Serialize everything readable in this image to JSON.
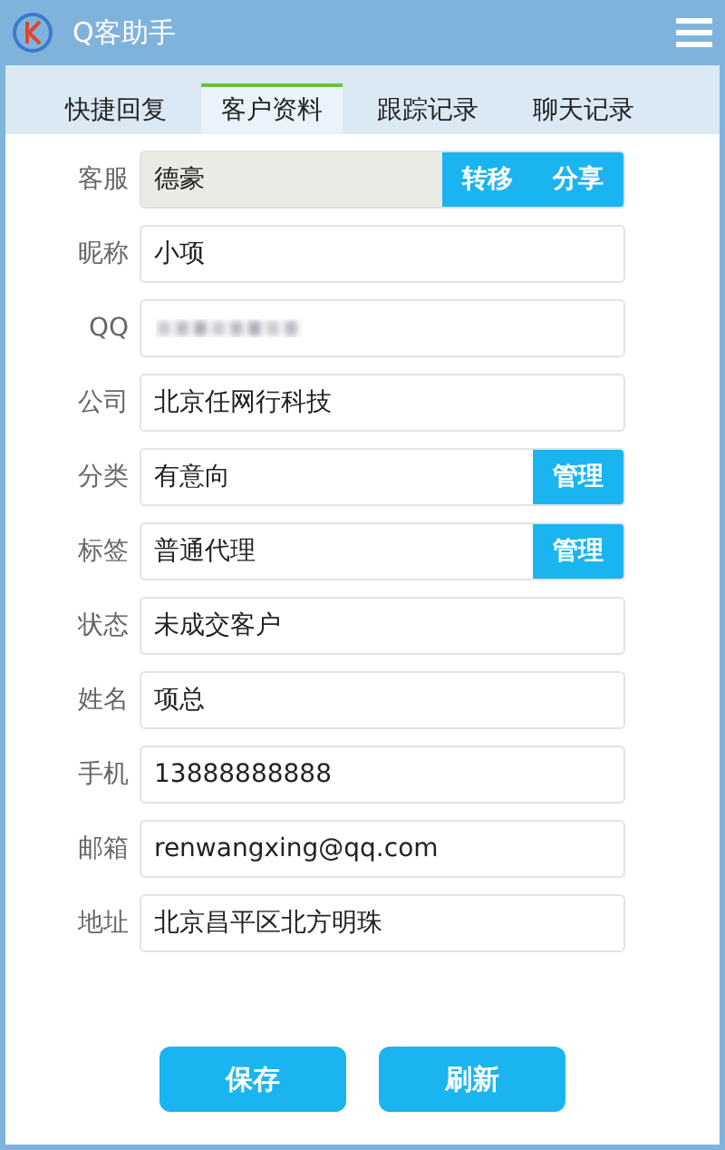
{
  "window": {
    "title": "Q客助手"
  },
  "tabs": [
    {
      "label": "快捷回复",
      "selected": false
    },
    {
      "label": "客户资料",
      "selected": true
    },
    {
      "label": "跟踪记录",
      "selected": false
    },
    {
      "label": "聊天记录",
      "selected": false
    }
  ],
  "fields": [
    {
      "label": "客服",
      "value": "德豪",
      "kind": "text",
      "readonly": true,
      "actions": [
        "转移",
        "分享"
      ]
    },
    {
      "label": "昵称",
      "value": "小项",
      "kind": "text",
      "readonly": false
    },
    {
      "label": "QQ",
      "kind": "redacted",
      "readonly": false
    },
    {
      "label": "公司",
      "value": "北京任网行科技",
      "kind": "text",
      "readonly": false
    },
    {
      "label": "分类",
      "value": "有意向",
      "kind": "text",
      "readonly": false,
      "actions": [
        "管理"
      ]
    },
    {
      "label": "标签",
      "value": "普通代理",
      "kind": "text",
      "readonly": false,
      "actions": [
        "管理"
      ]
    },
    {
      "label": "状态",
      "value": "未成交客户",
      "kind": "text",
      "readonly": false
    },
    {
      "label": "姓名",
      "value": "项总",
      "kind": "text",
      "readonly": false
    },
    {
      "label": "手机",
      "value": "13888888888",
      "kind": "text",
      "readonly": false
    },
    {
      "label": "邮箱",
      "value": "renwangxing@qq.com",
      "kind": "text",
      "readonly": false
    },
    {
      "label": "地址",
      "value": "北京昌平区北方明珠",
      "kind": "text",
      "readonly": false
    }
  ],
  "buttons": [
    "保存",
    "刷新"
  ]
}
